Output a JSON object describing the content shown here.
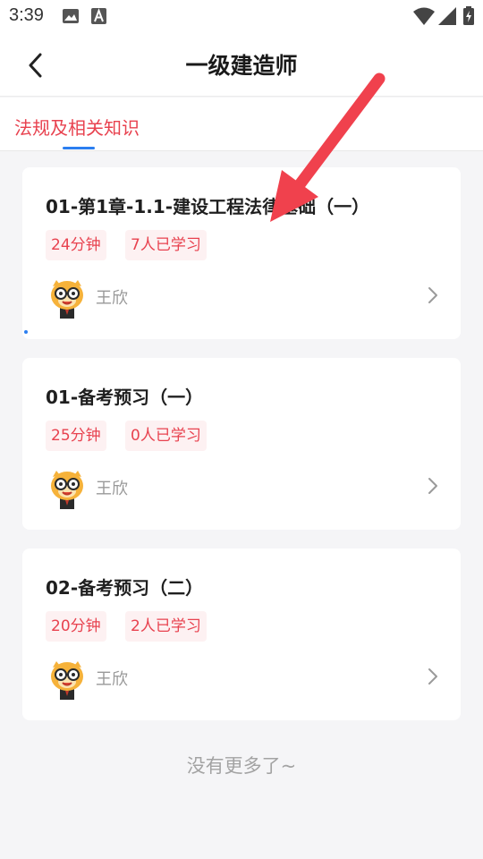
{
  "status_bar": {
    "time": "3:39",
    "icons": [
      "image-icon",
      "font-a-icon",
      "wifi-icon",
      "signal-icon",
      "battery-icon"
    ]
  },
  "header": {
    "title": "一级建造师",
    "back_icon": "chevron-left-icon"
  },
  "tabs": [
    {
      "label": "法规及相关知识",
      "active": true
    }
  ],
  "courses": [
    {
      "title": "01-第1章-1.1-建设工程法律基础（一）",
      "duration": "24分钟",
      "learners": "7人已学习",
      "teacher": "王欣"
    },
    {
      "title": "01-备考预习（一）",
      "duration": "25分钟",
      "learners": "0人已学习",
      "teacher": "王欣"
    },
    {
      "title": "02-备考预习（二）",
      "duration": "20分钟",
      "learners": "2人已学习",
      "teacher": "王欣"
    }
  ],
  "footer": {
    "end_text": "没有更多了~"
  },
  "colors": {
    "accent_red": "#e8424f",
    "tag_bg": "#fdf1f2",
    "indicator_blue": "#2b7ef0",
    "annotation_red": "#f0414d",
    "page_bg": "#f5f5f7"
  }
}
